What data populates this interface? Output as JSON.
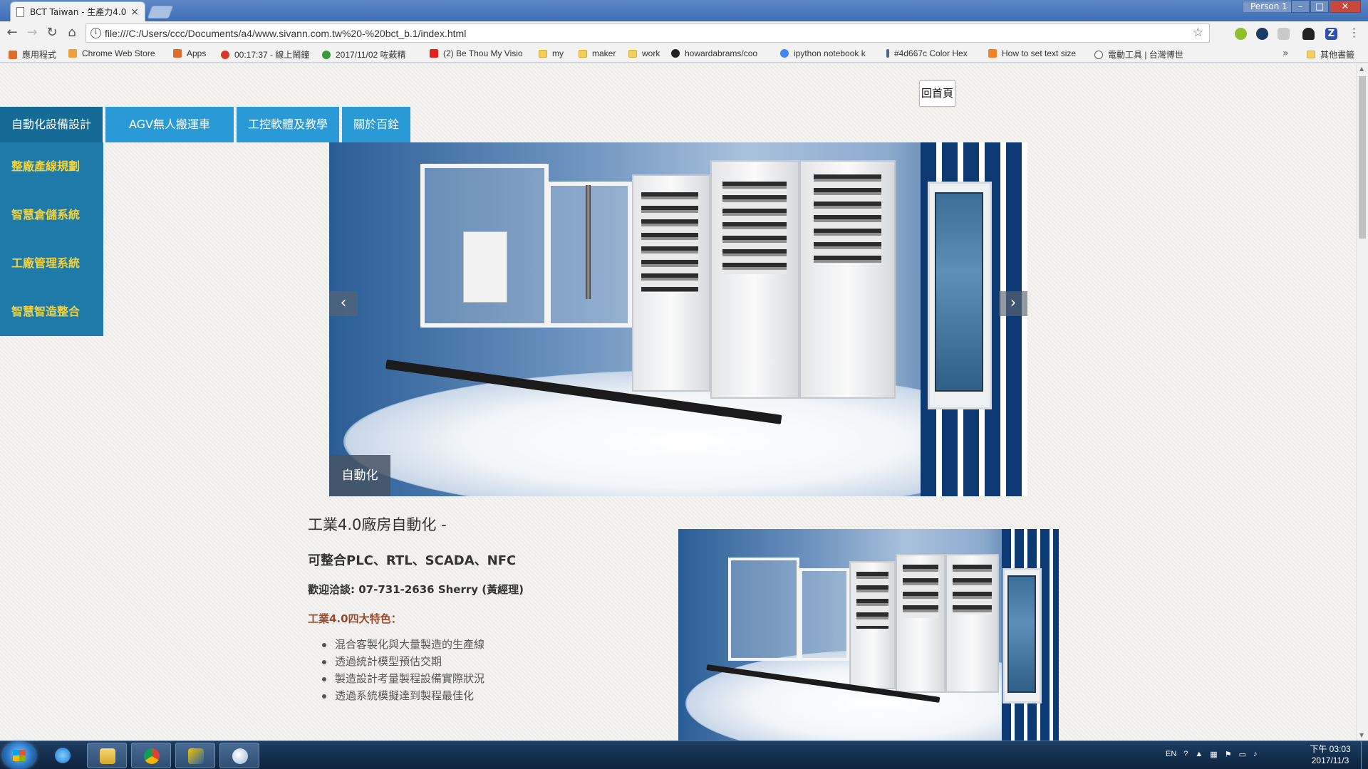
{
  "browser": {
    "tab_title": "BCT Taiwan - 生產力4.0",
    "person_label": "Person 1",
    "url": "file:///C:/Users/ccc/Documents/a4/www.sivann.com.tw%20-%20bct_b.1/index.html",
    "bookmarks": [
      {
        "label": "應用程式",
        "icon": "apps-grid-icon",
        "color": "#e06b2b"
      },
      {
        "label": "Chrome Web Store",
        "icon": "chrome-web-store-icon",
        "color": "#e9a23b"
      },
      {
        "label": "Apps",
        "icon": "apps-grid-icon",
        "color": "#e06b2b"
      },
      {
        "label": "00:17:37 - 線上鬧鐘",
        "icon": "alarm-clock-icon",
        "color": "#d9362c"
      },
      {
        "label": "2017/11/02 咗蔌精",
        "icon": "leaf-icon",
        "color": "#3a9a3a"
      },
      {
        "label": "(2) Be Thou My Visio",
        "icon": "youtube-icon",
        "color": "#e62117"
      },
      {
        "label": "my",
        "icon": "folder-icon",
        "color": "#f3cf5d"
      },
      {
        "label": "maker",
        "icon": "folder-icon",
        "color": "#f3cf5d"
      },
      {
        "label": "work",
        "icon": "folder-icon",
        "color": "#f3cf5d"
      },
      {
        "label": "howardabrams/coo",
        "icon": "github-icon",
        "color": "#222222"
      },
      {
        "label": "ipython notebook k",
        "icon": "google-icon",
        "color": "#4285f4"
      },
      {
        "label": "#4d667c Color Hex",
        "icon": "color-hex-icon",
        "color": "#4d667c"
      },
      {
        "label": "How to set text size",
        "icon": "stackoverflow-icon",
        "color": "#f48024"
      },
      {
        "label": "電動工具 | 台灣博世",
        "icon": "bosch-icon",
        "color": "#555555"
      }
    ],
    "other_bookmarks": "其他書籤"
  },
  "page": {
    "home_button": "回首頁",
    "nav": [
      {
        "label": "自動化設備設計",
        "active": true
      },
      {
        "label": "AGV無人搬運車",
        "active": false
      },
      {
        "label": "工控軟體及教學",
        "active": false
      },
      {
        "label": "關於百銓",
        "active": false
      }
    ],
    "sidebar": [
      "整廠產線規劃",
      "智慧倉儲系統",
      "工廠管理系統",
      "智慧智造整合"
    ],
    "carousel": {
      "caption": "自動化",
      "prev": "‹",
      "next": "›"
    },
    "content": {
      "title": "工業4.0廠房自動化 -",
      "subtitle": "可整合PLC、RTL、SCADA、NFC",
      "contact": "歡迎洽談: 07-731-2636 Sherry (黃經理)",
      "features_heading": "工業4.0四大特色：",
      "features": [
        "混合客製化與大量製造的生產線",
        "透過統計模型預估交期",
        "製造設計考量製程設備實際狀況",
        "透過系統模擬達到製程最佳化"
      ]
    },
    "colors": {
      "nav_blue": "#2a9ad6",
      "nav_active": "#166b96",
      "sidebar_bg": "#1e7aa8",
      "sidebar_text": "#f3d23a",
      "features_heading": "#9a4a2c"
    }
  },
  "taskbar": {
    "apps": [
      {
        "name": "internet-explorer-icon",
        "open": false
      },
      {
        "name": "file-explorer-icon",
        "open": true
      },
      {
        "name": "chrome-icon",
        "open": true
      },
      {
        "name": "app-icon",
        "open": true
      },
      {
        "name": "paint-icon",
        "open": true
      }
    ],
    "language": "EN",
    "time": "下午 03:03",
    "date": "2017/11/3"
  }
}
